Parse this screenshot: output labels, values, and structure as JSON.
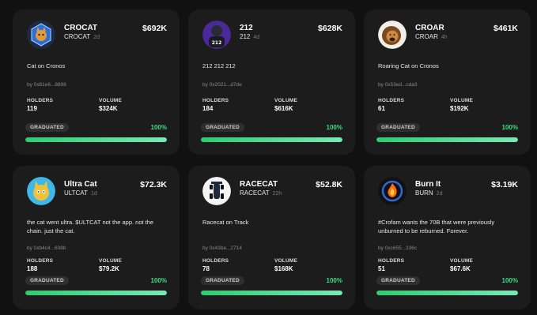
{
  "colors": {
    "accent_green": "#3ddc84",
    "card_bg": "#1c1c1c",
    "page_bg": "#111111"
  },
  "labels": {
    "holders": "HOLDERS",
    "volume": "VOLUME"
  },
  "cards": [
    {
      "name": "CROCAT",
      "ticker": "CROCAT",
      "age": "2d",
      "market_cap": "$692K",
      "icon": "crocat-avatar",
      "description": "Cat on Cronos",
      "creator": "by 0x81e6...8898",
      "holders": "119",
      "volume": "$324K",
      "status": "GRADUATED",
      "progress_label": "100%",
      "progress": 1.0
    },
    {
      "name": "212",
      "ticker": "212",
      "age": "4d",
      "market_cap": "$628K",
      "icon": "212-avatar",
      "description": "212 212 212",
      "creator": "by 0x2021...d7de",
      "holders": "184",
      "volume": "$616K",
      "status": "GRADUATED",
      "progress_label": "100%",
      "progress": 1.0
    },
    {
      "name": "CROAR",
      "ticker": "CROAR",
      "age": "4h",
      "market_cap": "$461K",
      "icon": "lion-avatar",
      "description": "Roaring Cat on Cronos",
      "creator": "by 0x53ed...cda3",
      "holders": "61",
      "volume": "$192K",
      "status": "GRADUATED",
      "progress_label": "100%",
      "progress": 1.0
    },
    {
      "name": "Ultra Cat",
      "ticker": "ULTCAT",
      "age": "1d",
      "market_cap": "$72.3K",
      "icon": "ultra-cat-avatar",
      "description": "the cat went ultra. $ULTCAT not the app. not the chain. just the cat.",
      "creator": "by 0xb4c4...608b",
      "holders": "188",
      "volume": "$79.2K",
      "status": "GRADUATED",
      "progress_label": "100%",
      "progress": 1.0
    },
    {
      "name": "RACECAT",
      "ticker": "RACECAT",
      "age": "22h",
      "market_cap": "$52.8K",
      "icon": "race-car-avatar",
      "description": "Racecat on Track",
      "creator": "by 0x43be...2714",
      "holders": "78",
      "volume": "$168K",
      "status": "GRADUATED",
      "progress_label": "100%",
      "progress": 1.0
    },
    {
      "name": "Burn It",
      "ticker": "BURN",
      "age": "2d",
      "market_cap": "$3.19K",
      "icon": "fire-coin-avatar",
      "description": "#Crofam wants the 70B that were previously unburned to be reburned. Forever.",
      "creator": "by 0xc655...336c",
      "holders": "51",
      "volume": "$67.6K",
      "status": "GRADUATED",
      "progress_label": "100%",
      "progress": 1.0
    }
  ]
}
